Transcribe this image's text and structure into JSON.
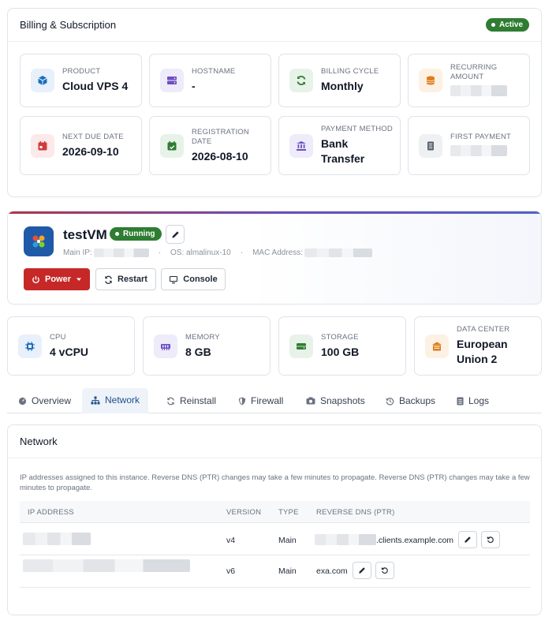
{
  "billing": {
    "title": "Billing & Subscription",
    "status": "Active",
    "tiles": [
      {
        "label": "PRODUCT",
        "value": "Cloud VPS 4",
        "icon": "cube-icon",
        "color": "#1e6fb8",
        "bg": "#e8f0fb"
      },
      {
        "label": "HOSTNAME",
        "value": "-",
        "icon": "server-icon",
        "color": "#6d4fc2",
        "bg": "#eeebfa"
      },
      {
        "label": "BILLING CYCLE",
        "value": "Monthly",
        "icon": "sync-icon",
        "color": "#2e7d32",
        "bg": "#e7f3e8"
      },
      {
        "label": "RECURRING AMOUNT",
        "value": "",
        "icon": "coins-icon",
        "color": "#e07b1a",
        "bg": "#fdf1e4"
      },
      {
        "label": "NEXT DUE DATE",
        "value": "2026-09-10",
        "icon": "calendar-icon",
        "color": "#d23b3b",
        "bg": "#fce9e9"
      },
      {
        "label": "REGISTRATION DATE",
        "value": "2026-08-10",
        "icon": "calendar-check-icon",
        "color": "#2e7d32",
        "bg": "#e7f3e8"
      },
      {
        "label": "PAYMENT METHOD",
        "value": "Bank Transfer",
        "icon": "bank-icon",
        "color": "#6d4fc2",
        "bg": "#eeebfa"
      },
      {
        "label": "FIRST PAYMENT",
        "value": "",
        "icon": "receipt-icon",
        "color": "#5b6470",
        "bg": "#eef0f2"
      }
    ]
  },
  "vm": {
    "name": "testVM",
    "status": "Running",
    "main_ip_label": "Main IP:",
    "os_label": "OS: almalinux-10",
    "mac_label": "MAC Address:",
    "power_label": "Power",
    "restart_label": "Restart",
    "console_label": "Console"
  },
  "specs": [
    {
      "label": "CPU",
      "value": "4 vCPU",
      "icon": "cpu-icon",
      "color": "#1e6fb8",
      "bg": "#e8f0fb"
    },
    {
      "label": "MEMORY",
      "value": "8 GB",
      "icon": "memory-icon",
      "color": "#6d4fc2",
      "bg": "#eeebfa"
    },
    {
      "label": "STORAGE",
      "value": "100 GB",
      "icon": "hdd-icon",
      "color": "#2e7d32",
      "bg": "#e7f3e8"
    },
    {
      "label": "DATA CENTER",
      "value": "European Union 2",
      "icon": "building-icon",
      "color": "#e07b1a",
      "bg": "#fdf1e4"
    }
  ],
  "tabs": [
    {
      "label": "Overview",
      "icon": "gauge-icon"
    },
    {
      "label": "Network",
      "icon": "network-icon"
    },
    {
      "label": "Reinstall",
      "icon": "sync-icon"
    },
    {
      "label": "Firewall",
      "icon": "shield-icon"
    },
    {
      "label": "Snapshots",
      "icon": "camera-icon"
    },
    {
      "label": "Backups",
      "icon": "history-icon"
    },
    {
      "label": "Logs",
      "icon": "file-icon"
    }
  ],
  "active_tab": "Network",
  "network": {
    "title": "Network",
    "description": "IP addresses assigned to this instance. Reverse DNS (PTR) changes may take a few minutes to propagate. Reverse DNS (PTR) changes may take a few minutes to propagate.",
    "columns": [
      "IP ADDRESS",
      "VERSION",
      "TYPE",
      "REVERSE DNS (PTR)"
    ],
    "rows": [
      {
        "ip": "",
        "version": "v4",
        "type": "Main",
        "ptr": ".clients.example.com"
      },
      {
        "ip": "",
        "version": "v6",
        "type": "Main",
        "ptr": "exa.com"
      }
    ]
  }
}
